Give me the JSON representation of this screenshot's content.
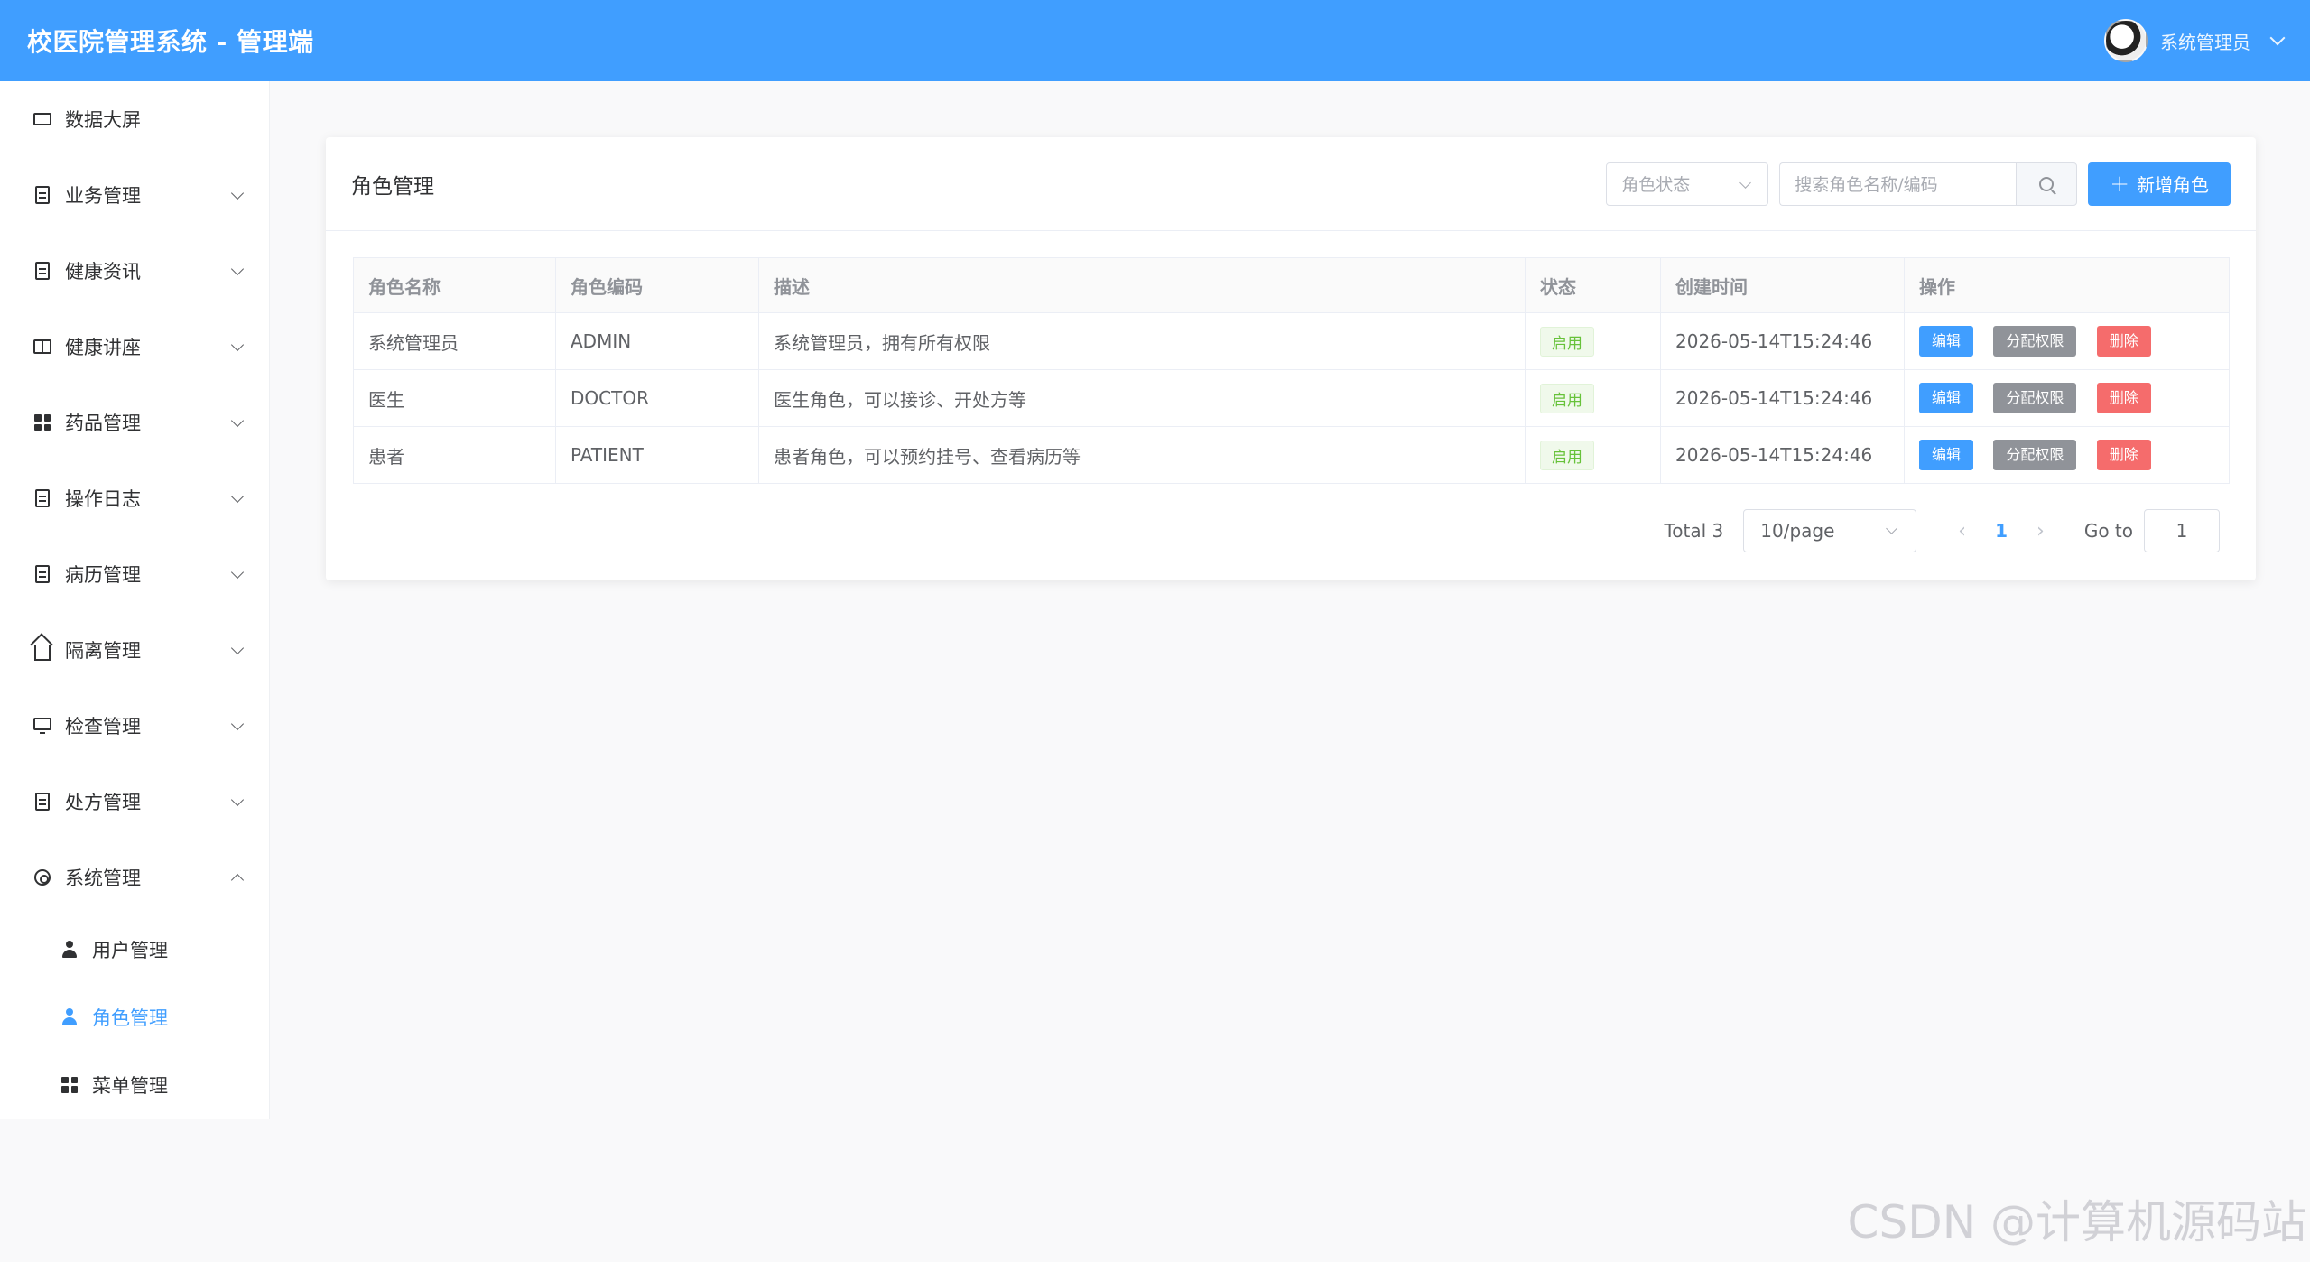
{
  "header": {
    "title": "校医院管理系统 - 管理端",
    "user_name": "系统管理员"
  },
  "sidebar": {
    "items": [
      {
        "label": "数据大屏",
        "icon": "screen-icon",
        "has_arrow": false
      },
      {
        "label": "业务管理",
        "icon": "building-icon",
        "has_arrow": true
      },
      {
        "label": "健康资讯",
        "icon": "document-icon",
        "has_arrow": true
      },
      {
        "label": "健康讲座",
        "icon": "book-icon",
        "has_arrow": true
      },
      {
        "label": "药品管理",
        "icon": "grid-icon",
        "has_arrow": true
      },
      {
        "label": "操作日志",
        "icon": "document-icon",
        "has_arrow": true
      },
      {
        "label": "病历管理",
        "icon": "document-icon",
        "has_arrow": true
      },
      {
        "label": "隔离管理",
        "icon": "house-icon",
        "has_arrow": true
      },
      {
        "label": "检查管理",
        "icon": "monitor-icon",
        "has_arrow": true
      },
      {
        "label": "处方管理",
        "icon": "document-icon",
        "has_arrow": true
      },
      {
        "label": "系统管理",
        "icon": "gear-icon",
        "has_arrow": true,
        "expanded": true
      }
    ],
    "sub_items": [
      {
        "label": "用户管理",
        "icon": "user-icon",
        "active": false
      },
      {
        "label": "角色管理",
        "icon": "user-icon",
        "active": true
      },
      {
        "label": "菜单管理",
        "icon": "grid-icon",
        "active": false
      }
    ]
  },
  "main": {
    "title": "角色管理",
    "status_select_placeholder": "角色状态",
    "search_placeholder": "搜索角色名称/编码",
    "add_button": "新增角色"
  },
  "table": {
    "headers": [
      "角色名称",
      "角色编码",
      "描述",
      "状态",
      "创建时间",
      "操作"
    ],
    "rows": [
      {
        "name": "系统管理员",
        "code": "ADMIN",
        "desc": "系统管理员，拥有所有权限",
        "status": "启用",
        "created": "2026-05-14T15:24:46"
      },
      {
        "name": "医生",
        "code": "DOCTOR",
        "desc": "医生角色，可以接诊、开处方等",
        "status": "启用",
        "created": "2026-05-14T15:24:46"
      },
      {
        "name": "患者",
        "code": "PATIENT",
        "desc": "患者角色，可以预约挂号、查看病历等",
        "status": "启用",
        "created": "2026-05-14T15:24:46"
      }
    ],
    "actions": {
      "edit": "编辑",
      "permission": "分配权限",
      "delete": "删除"
    }
  },
  "pagination": {
    "total": "Total 3",
    "page_size": "10/page",
    "current_page": "1",
    "goto_label": "Go to",
    "goto_value": "1"
  },
  "watermark": "CSDN @计算机源码站",
  "colors": {
    "primary": "#409eff",
    "success": "#67c23a",
    "danger": "#f56c6c",
    "info": "#909399"
  }
}
